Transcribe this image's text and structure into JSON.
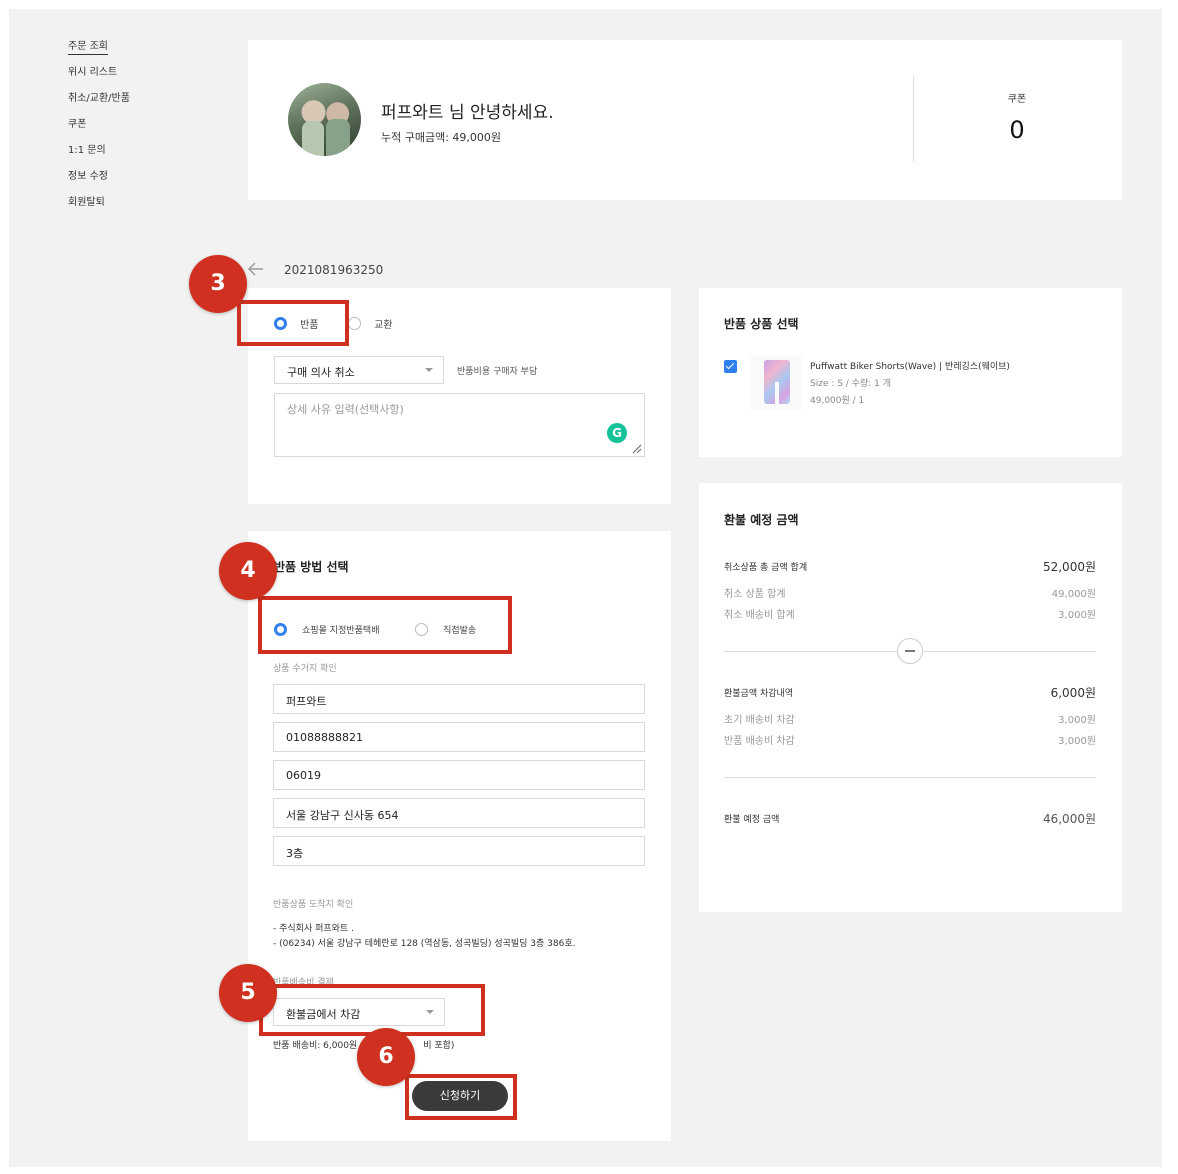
{
  "sidebar": {
    "items": [
      {
        "label": "주문 조회"
      },
      {
        "label": "위시 리스트"
      },
      {
        "label": "취소/교환/반품"
      },
      {
        "label": "쿠폰"
      },
      {
        "label": "1:1 문의"
      },
      {
        "label": "정보 수정"
      },
      {
        "label": "회원탈퇴"
      }
    ]
  },
  "profile": {
    "greeting": "퍼프와트 님 안녕하세요.",
    "accumulated": "누적 구매금액: 49,000원",
    "coupon_label": "쿠폰",
    "coupon_count": "0"
  },
  "order": {
    "number": "2021081963250"
  },
  "request_type": {
    "options": [
      "반품",
      "교환"
    ],
    "selected": "반품"
  },
  "reason": {
    "selected": "구매 의사 취소",
    "cost_note": "반품비용 구매자 부담",
    "detail_placeholder": "상세 사유 입력(선택사항)"
  },
  "return_method": {
    "title": "반품 방법 선택",
    "options": [
      "쇼핑몰 지정반품택배",
      "직접발송"
    ],
    "selected": "쇼핑몰 지정반품택배",
    "pickup_label": "상품 수거지 확인",
    "fields": {
      "name": "퍼프와트",
      "phone": "01088888821",
      "zip": "06019",
      "address1": "서울 강남구 신사동 654",
      "address2": "3층"
    },
    "arrival_label": "반품상품 도착지 확인",
    "arrival_lines": [
      "- 주식회사 퍼프와트 .",
      "- (06234) 서울 강남구 테헤란로 128 (역삼동, 성곡빌딩) 성곡빌딩 3층 386호."
    ],
    "payment_label": "반품배송비 결제",
    "payment_selected": "환불금에서 차감",
    "fee_note": "반품 배송비: 6,000원 (초기 배송비 포함)",
    "fee_note_left": "반품 배송비: 6,000원",
    "fee_note_right": "비 포함)",
    "submit": "신청하기"
  },
  "product_select": {
    "title": "반품 상품 선택",
    "product_name": "Puffwatt Biker Shorts(Wave) | 반레깅스(웨이브)",
    "option": "Size : S / 수량: 1 개",
    "price": "49,000원 / 1",
    "checked": true
  },
  "refund": {
    "title": "환불 예정 금액",
    "cancel_total_label": "취소상품 총 금액 합계",
    "cancel_total_value": "52,000원",
    "cancel_items_label": "취소 상품 합계",
    "cancel_items_value": "49,000원",
    "cancel_shipping_label": "취소 배송비 합계",
    "cancel_shipping_value": "3,000원",
    "deduct_label": "환불금액 차감내역",
    "deduct_value": "6,000원",
    "initial_shipping_label": "초기 배송비 차감",
    "initial_shipping_value": "3,000원",
    "return_shipping_label": "반품 배송비 차감",
    "return_shipping_value": "3,000원",
    "expected_label": "환불 예정 금액",
    "expected_value": "46,000원"
  },
  "annotations": [
    "3",
    "4",
    "5",
    "6"
  ],
  "colors": {
    "accent": "#2f7ff0",
    "annotation": "#d0301f",
    "button": "#3a3a3a"
  }
}
